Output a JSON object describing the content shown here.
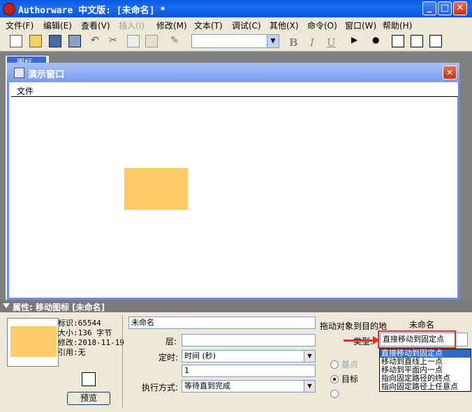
{
  "titlebar": {
    "title": "Authorware 中文版: [未命名] *",
    "min": "_",
    "max": "□",
    "close": "✕"
  },
  "menubar": {
    "items": [
      {
        "label": "文件(F)"
      },
      {
        "label": "编辑(E)"
      },
      {
        "label": "查看(V)"
      },
      {
        "label": "插入(I)",
        "disabled": true
      },
      {
        "label": "修改(M)"
      },
      {
        "label": "文本(T)"
      },
      {
        "label": "调试(C)"
      },
      {
        "label": "其他(X)"
      },
      {
        "label": "命令(O)"
      },
      {
        "label": "窗口(W)"
      },
      {
        "label": "帮助(H)"
      }
    ]
  },
  "toolbar": {
    "bold": "B",
    "italic": "I",
    "underline": "U",
    "font_combo_value": ""
  },
  "flowline": {
    "title": "图标"
  },
  "presentation": {
    "title": "演示窗口",
    "menu_file": "文件",
    "close": "✕",
    "rect_color": "#fdcb65"
  },
  "properties": {
    "title": "属性: 移动图标 [未命名]",
    "id_label": "标识:65544",
    "size_label": "大小:136 字节",
    "modified_label": "修改:2018-11-19",
    "ref_label": "引用:无",
    "preview_button": "预览",
    "name_value": "未命名",
    "layer_label": "层:",
    "layer_value": "",
    "timing_label": "定时:",
    "timing_value": "时间 (秒)",
    "time_value": "1",
    "exec_label": "执行方式:",
    "exec_value": "等待直到完成",
    "drag_label": "拖动对象到目的地",
    "drag_value": "未命名",
    "type_label": "类型:",
    "type_value": "直接移动到固定点",
    "radio_base": "基点",
    "radio_target": "目标",
    "type_options": [
      "直接移动到固定点",
      "移动到直线上一点",
      "移动到平面内一点",
      "指向固定路径的终点",
      "指向固定路径上任意点"
    ]
  },
  "colors": {
    "accent": "#e03030",
    "shape": "#fdcb65"
  }
}
